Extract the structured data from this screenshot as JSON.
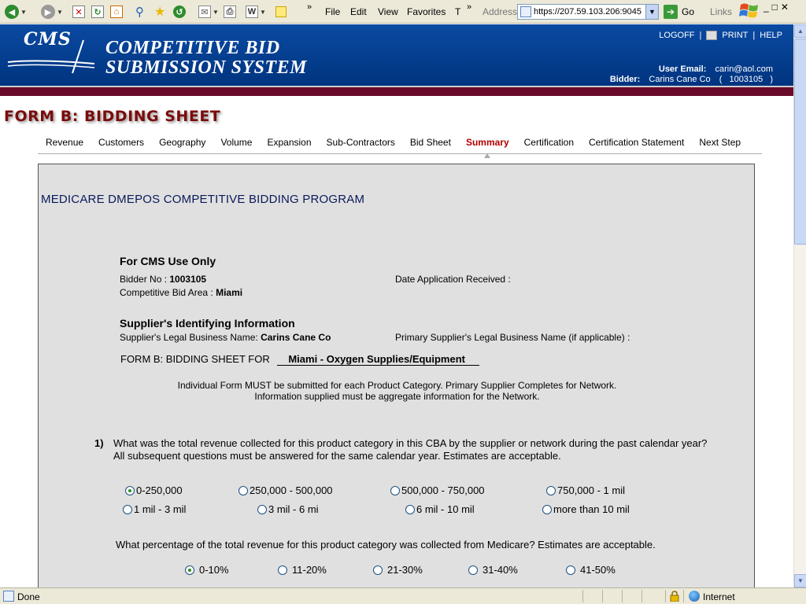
{
  "browser": {
    "menu": [
      "File",
      "Edit",
      "View",
      "Favorites",
      "T"
    ],
    "address_label": "Address",
    "address_url": "https://207.59.103.206:9045",
    "go_label": "Go",
    "links_label": "Links"
  },
  "header": {
    "logo_text": "CMS",
    "title_line1": "COMPETITIVE BID",
    "title_line2": "SUBMISSION SYSTEM",
    "logoff": "LOGOFF",
    "print": "PRINT",
    "help": "HELP",
    "user_email_label": "User Email:",
    "user_email": "carin@aol.com",
    "bidder_label": "Bidder:",
    "bidder_name": "Carins Cane Co",
    "bidder_id": "( 1003105 )"
  },
  "form_title": "FORM B:  BIDDING SHEET",
  "tabs": [
    {
      "label": "Revenue"
    },
    {
      "label": "Customers"
    },
    {
      "label": "Geography"
    },
    {
      "label": "Volume"
    },
    {
      "label": "Expansion"
    },
    {
      "label": "Sub-Contractors"
    },
    {
      "label": "Bid Sheet"
    },
    {
      "label": "Summary",
      "active": true
    },
    {
      "label": "Certification"
    },
    {
      "label": "Certification Statement"
    },
    {
      "label": "Next Step"
    }
  ],
  "content": {
    "program_title": "MEDICARE DMEPOS COMPETITIVE BIDDING PROGRAM",
    "cms_use_heading": "For CMS Use Only",
    "bidder_no_label": "Bidder No :",
    "bidder_no": "1003105",
    "cba_label": "Competitive Bid Area :",
    "cba_value": "Miami",
    "date_received_label": "Date Application Received :",
    "supplier_heading": "Supplier's Identifying Information",
    "legal_name_label": "Supplier's Legal Business Name:",
    "legal_name": "Carins Cane Co",
    "primary_label": "Primary Supplier's Legal Business Name (if applicable) :",
    "bidsheet_label": "FORM B: BIDDING SHEET FOR",
    "bidsheet_value": "Miami - Oxygen Supplies/Equipment",
    "notice_line1": "Individual Form MUST be submitted for each Product Category. Primary Supplier Completes for Network.",
    "notice_line2": "Information supplied must be aggregate information for the Network.",
    "q1_number": "1)",
    "q1_text": "What was the total revenue collected for this product category in this CBA by the supplier or network during the past calendar year? All subsequent questions must be answered for the same calendar year. Estimates are acceptable.",
    "q1_options": [
      {
        "label": "0-250,000",
        "selected": true
      },
      {
        "label": "250,000 - 500,000",
        "selected": false
      },
      {
        "label": "500,000 - 750,000",
        "selected": false
      },
      {
        "label": "750,000 - 1 mil",
        "selected": false
      },
      {
        "label": "1 mil - 3 mil",
        "selected": false
      },
      {
        "label": "3 mil - 6 mi",
        "selected": false
      },
      {
        "label": "6 mil - 10 mil",
        "selected": false
      },
      {
        "label": "more than 10 mil",
        "selected": false
      }
    ],
    "q2_text": "What percentage of the total revenue for this product category was collected from Medicare? Estimates are acceptable.",
    "q2_options": [
      {
        "label": "0-10%",
        "selected": true
      },
      {
        "label": "11-20%",
        "selected": false
      },
      {
        "label": "21-30%",
        "selected": false
      },
      {
        "label": "31-40%",
        "selected": false
      },
      {
        "label": "41-50%",
        "selected": false
      }
    ]
  },
  "status": {
    "text": "Done",
    "zone": "Internet"
  },
  "colors": {
    "header_blue": "#00347f",
    "maroon_bar": "#6a0a2a",
    "form_title": "#7a0c0c",
    "active_tab": "#b00000",
    "panel_bg": "#e0e0e0"
  }
}
